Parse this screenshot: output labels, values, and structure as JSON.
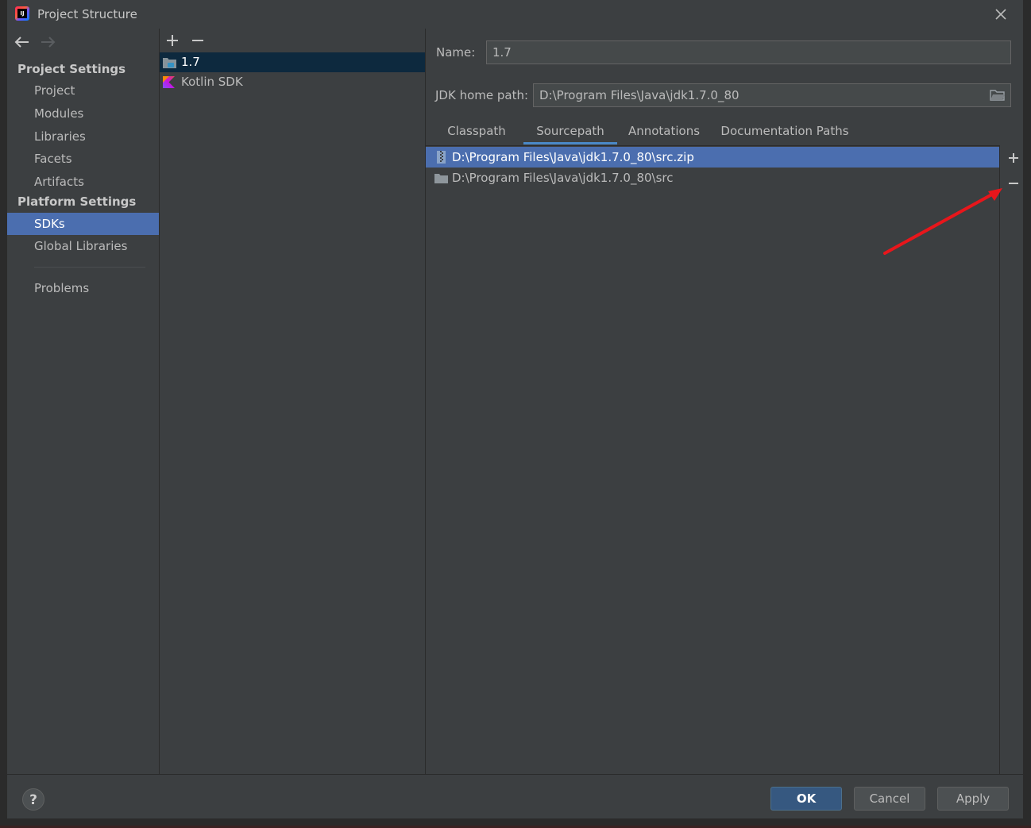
{
  "window": {
    "title": "Project Structure",
    "app_icon_text": "IJ"
  },
  "nav": {
    "project_settings_label": "Project Settings",
    "project_items": [
      "Project",
      "Modules",
      "Libraries",
      "Facets",
      "Artifacts"
    ],
    "platform_settings_label": "Platform Settings",
    "platform_items": [
      "SDKs",
      "Global Libraries"
    ],
    "selected": "SDKs",
    "problems_label": "Problems"
  },
  "sdk_list": {
    "items": [
      {
        "label": "1.7",
        "icon": "jdk-folder-icon",
        "selected": true
      },
      {
        "label": "Kotlin SDK",
        "icon": "kotlin-icon",
        "selected": false
      }
    ]
  },
  "details": {
    "name_label": "Name:",
    "name_value": "1.7",
    "jdk_home_label": "JDK home path:",
    "jdk_home_value": "D:\\Program Files\\Java\\jdk1.7.0_80",
    "tabs": [
      "Classpath",
      "Sourcepath",
      "Annotations",
      "Documentation Paths"
    ],
    "active_tab": "Sourcepath",
    "paths": [
      {
        "label": "D:\\Program Files\\Java\\jdk1.7.0_80\\src.zip",
        "icon": "archive-icon",
        "selected": true
      },
      {
        "label": "D:\\Program Files\\Java\\jdk1.7.0_80\\src",
        "icon": "folder-icon",
        "selected": false
      }
    ]
  },
  "footer": {
    "help_label": "?",
    "ok_label": "OK",
    "cancel_label": "Cancel",
    "apply_label": "Apply"
  },
  "colors": {
    "background": "#3c3f41",
    "selection": "#4b6eaf",
    "list_selection_dark": "#0d293e",
    "annotation_arrow": "#e8161b",
    "tab_underline": "#4a88c7"
  }
}
